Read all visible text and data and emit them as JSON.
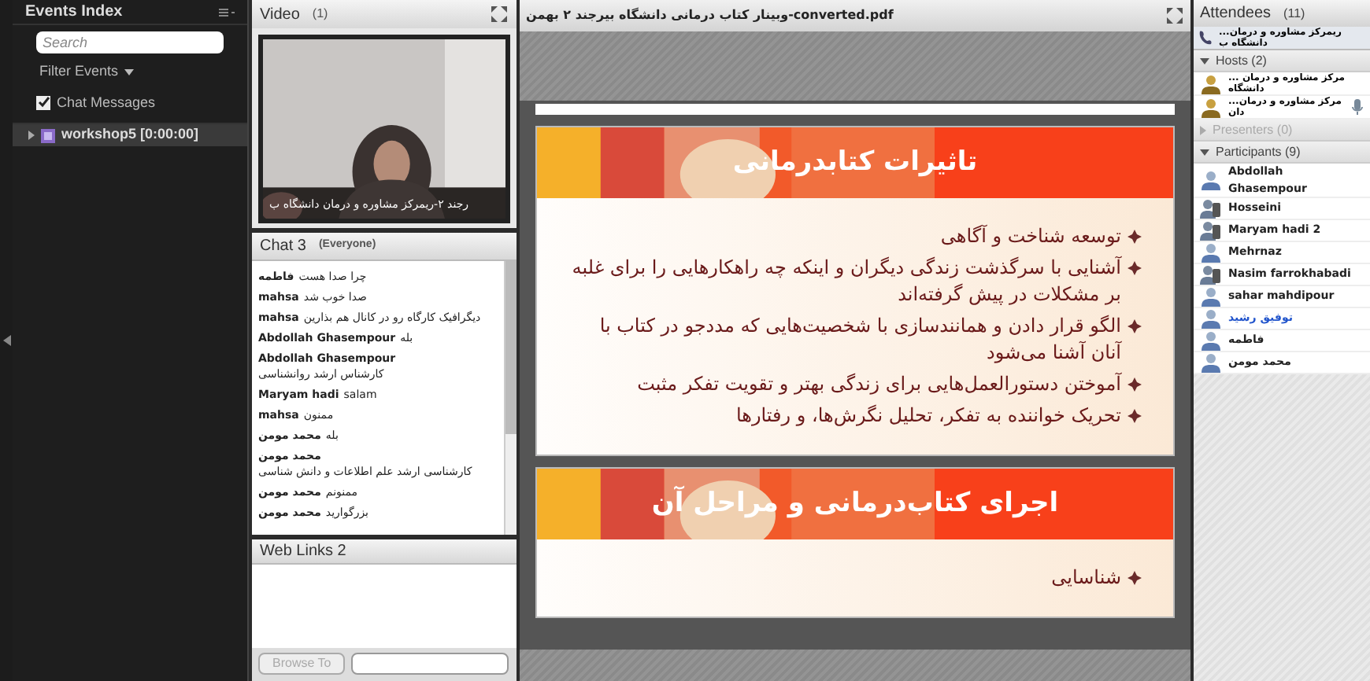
{
  "events": {
    "title": "Events Index",
    "search": {
      "placeholder": "Search"
    },
    "filter": "Filter Events",
    "chat_filter": {
      "label": "Chat Messages",
      "checked": true
    },
    "items": [
      {
        "label": "workshop5 [0:00:00]",
        "selected": true
      }
    ]
  },
  "video": {
    "title": "Video",
    "count": "(1)",
    "caption": "رجند ۲-ریمرکز مشاوره و درمان دانشگاه ب"
  },
  "chat": {
    "title": "Chat 3",
    "scope": "(Everyone)",
    "messages": [
      {
        "name": "فاطمه",
        "text": "چرا صدا هست"
      },
      {
        "name": "mahsa",
        "text": "صدا خوب شد"
      },
      {
        "name": "mahsa",
        "text": "دیگرافیک کارگاه رو در کانال هم بذارین"
      },
      {
        "name": "Abdollah Ghasempour",
        "text": "بله"
      },
      {
        "name": "Abdollah Ghasempour",
        "text": "کارشناس ارشد روانشناسی"
      },
      {
        "name": "Maryam hadi",
        "text": "salam"
      },
      {
        "name": "mahsa",
        "text": "ممنون"
      },
      {
        "name": "محمد مومن",
        "text": "بله"
      },
      {
        "name": "محمد مومن",
        "text": "کارشناسی ارشد علم اطلاعات و دانش شناسی"
      },
      {
        "name": "محمد مومن",
        "text": "ممنونم"
      },
      {
        "name": "محمد مومن",
        "text": "بزرگوارید"
      }
    ]
  },
  "web_links": {
    "title": "Web Links 2",
    "button": "Browse To",
    "button_disabled": true
  },
  "document": {
    "title": "وبینار کتاب درمانی دانشگاه بیرجند ۲ بهمن-converted.pdf",
    "slides": [
      {
        "title": "تاثیرات کتابدرمانی",
        "bullets": [
          "توسعه شناخت و آگاهی",
          "آشنایی با سرگذشت زندگی دیگران و اینکه چه راهکارهایی را برای غلبه بر مشکلات در پیش گرفته‌اند",
          "الگو قرار دادن و همانندسازی با شخصیت‌هایی که مددجو در کتاب با آنان آشنا می‌شود",
          "آموختن دستورالعمل‌هایی برای زندگی بهتر و تقویت تفکر مثبت",
          "تحریک خواننده به تفکر، تحلیل نگرش‌ها، و رفتارها"
        ]
      },
      {
        "title": "اجرای کتاب‌درمانی و مراحل آن",
        "bullets": [
          "شناسایی"
        ]
      }
    ]
  },
  "attendees": {
    "title": "Attendees",
    "count": "(11)",
    "me": "...ریمرکز مشاوره و درمان دانشگاه ب",
    "groups": [
      {
        "title": "Hosts (2)",
        "expanded": true,
        "people": [
          {
            "name": "... مرکز مشاوره و درمان دانشگاه",
            "kind": "host"
          },
          {
            "name": "...مرکز مشاوره و درمان دان",
            "kind": "host",
            "speaking": true
          }
        ]
      },
      {
        "title": "Presenters (0)",
        "expanded": false
      },
      {
        "title": "Participants (9)",
        "expanded": true,
        "people": [
          {
            "name": "Abdollah Ghasempour",
            "kind": "user",
            "color": "#222222"
          },
          {
            "name": "Hosseini",
            "kind": "phone",
            "color": "#222222"
          },
          {
            "name": "Maryam hadi 2",
            "kind": "phone",
            "color": "#222222"
          },
          {
            "name": "Mehrnaz",
            "kind": "user",
            "color": "#222222"
          },
          {
            "name": "Nasim farrokhabadi",
            "kind": "phone",
            "color": "#222222"
          },
          {
            "name": "sahar mahdipour",
            "kind": "user",
            "color": "#222222"
          },
          {
            "name": "توفیق رشید",
            "kind": "user",
            "color": "#2255cc"
          },
          {
            "name": "فاطمه",
            "kind": "user",
            "color": "#222222"
          },
          {
            "name": "محمد مومن",
            "kind": "user",
            "color": "#222222"
          }
        ]
      }
    ]
  }
}
